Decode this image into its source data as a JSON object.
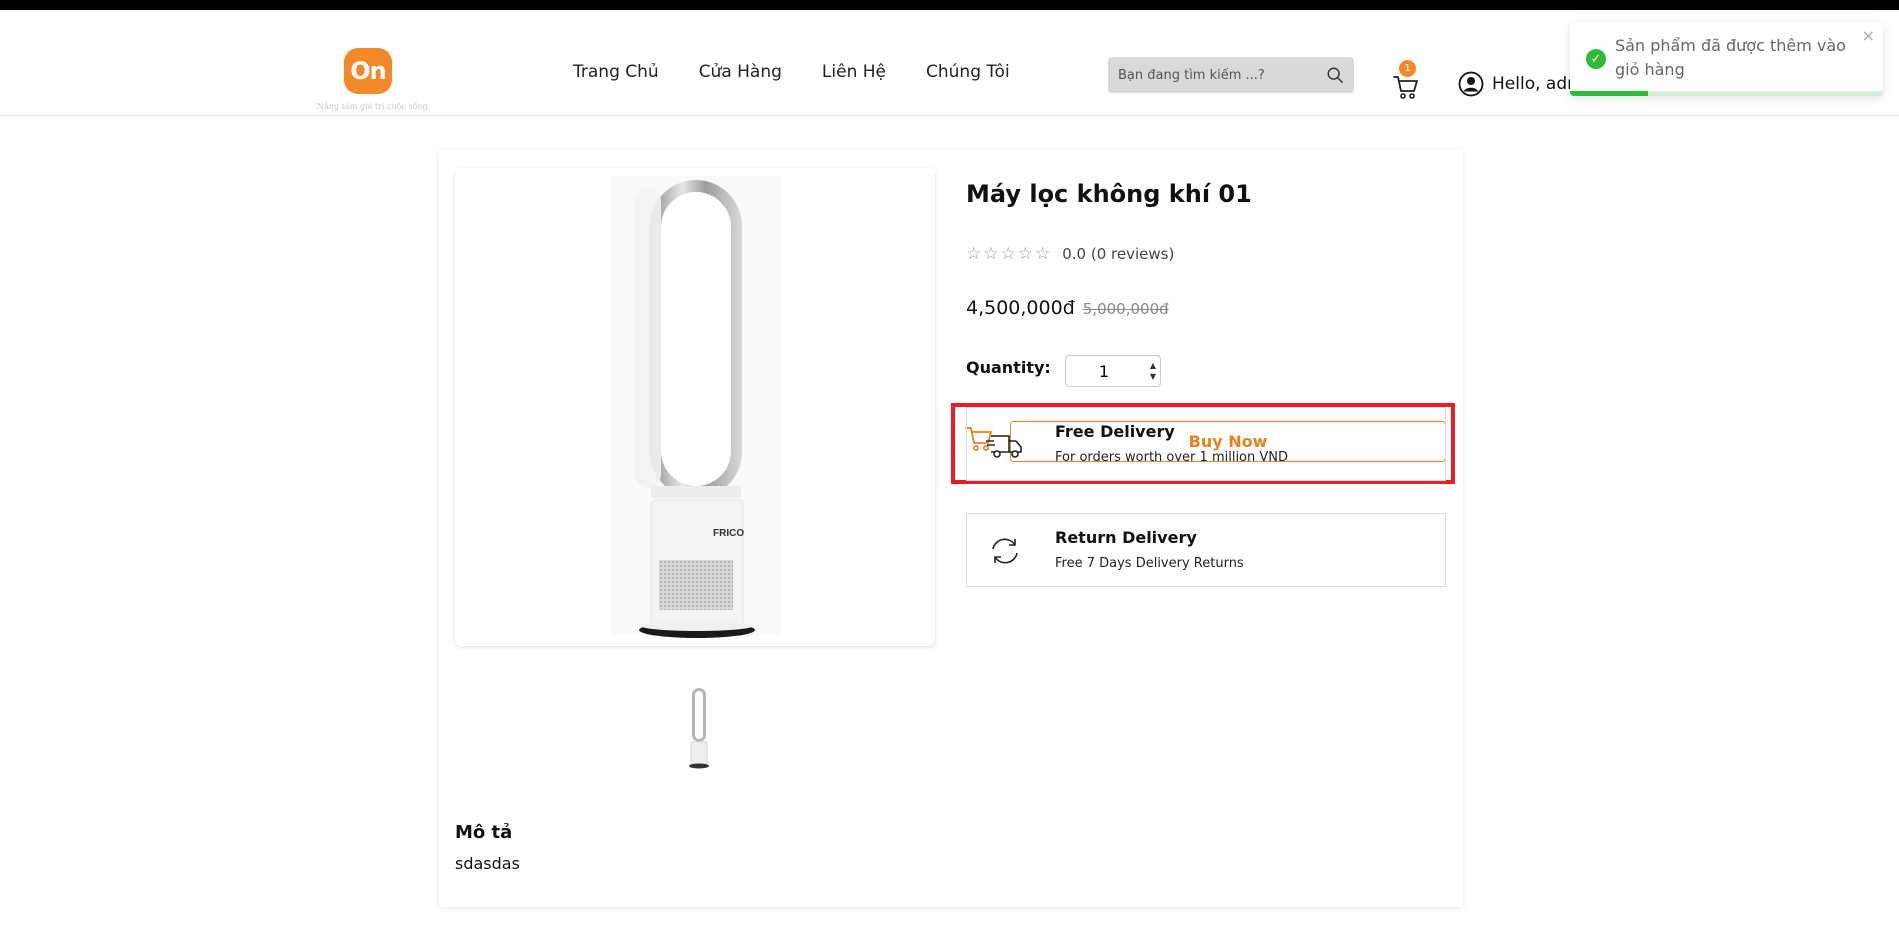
{
  "header": {
    "logo_text": "On",
    "logo_tagline": "Nâng tầm giá trị cuộc sống",
    "nav": [
      "Trang Chủ",
      "Cửa Hàng",
      "Liên Hệ",
      "Chúng Tôi"
    ],
    "search_placeholder": "Bạn đang tìm kiếm ...?",
    "cart_count": "1",
    "user_greeting": "Hello, adm"
  },
  "toast": {
    "message": "Sản phẩm đã được thêm vào giỏ hàng",
    "close": "×",
    "progress": 0.25
  },
  "product": {
    "title": "Máy lọc không khí 01",
    "rating_text": "0.0 (0 reviews)",
    "rating_value": 0,
    "price": "4,500,000đ",
    "old_price": "5,000,000đ",
    "quantity_label": "Quantity:",
    "quantity": "1",
    "buy_now": "Buy Now",
    "image_brand": "FRICO",
    "features": [
      {
        "title": "Free Delivery",
        "desc": "For orders worth over 1 million VND",
        "icon": "truck-icon"
      },
      {
        "title": "Return Delivery",
        "desc": "Free 7 Days Delivery Returns",
        "icon": "refresh-icon"
      }
    ]
  },
  "description": {
    "title": "Mô tả",
    "text": "sdasdas"
  },
  "colors": {
    "accent": "#f28a2a",
    "highlight": "#ec1c24",
    "success": "#2fba3c"
  }
}
